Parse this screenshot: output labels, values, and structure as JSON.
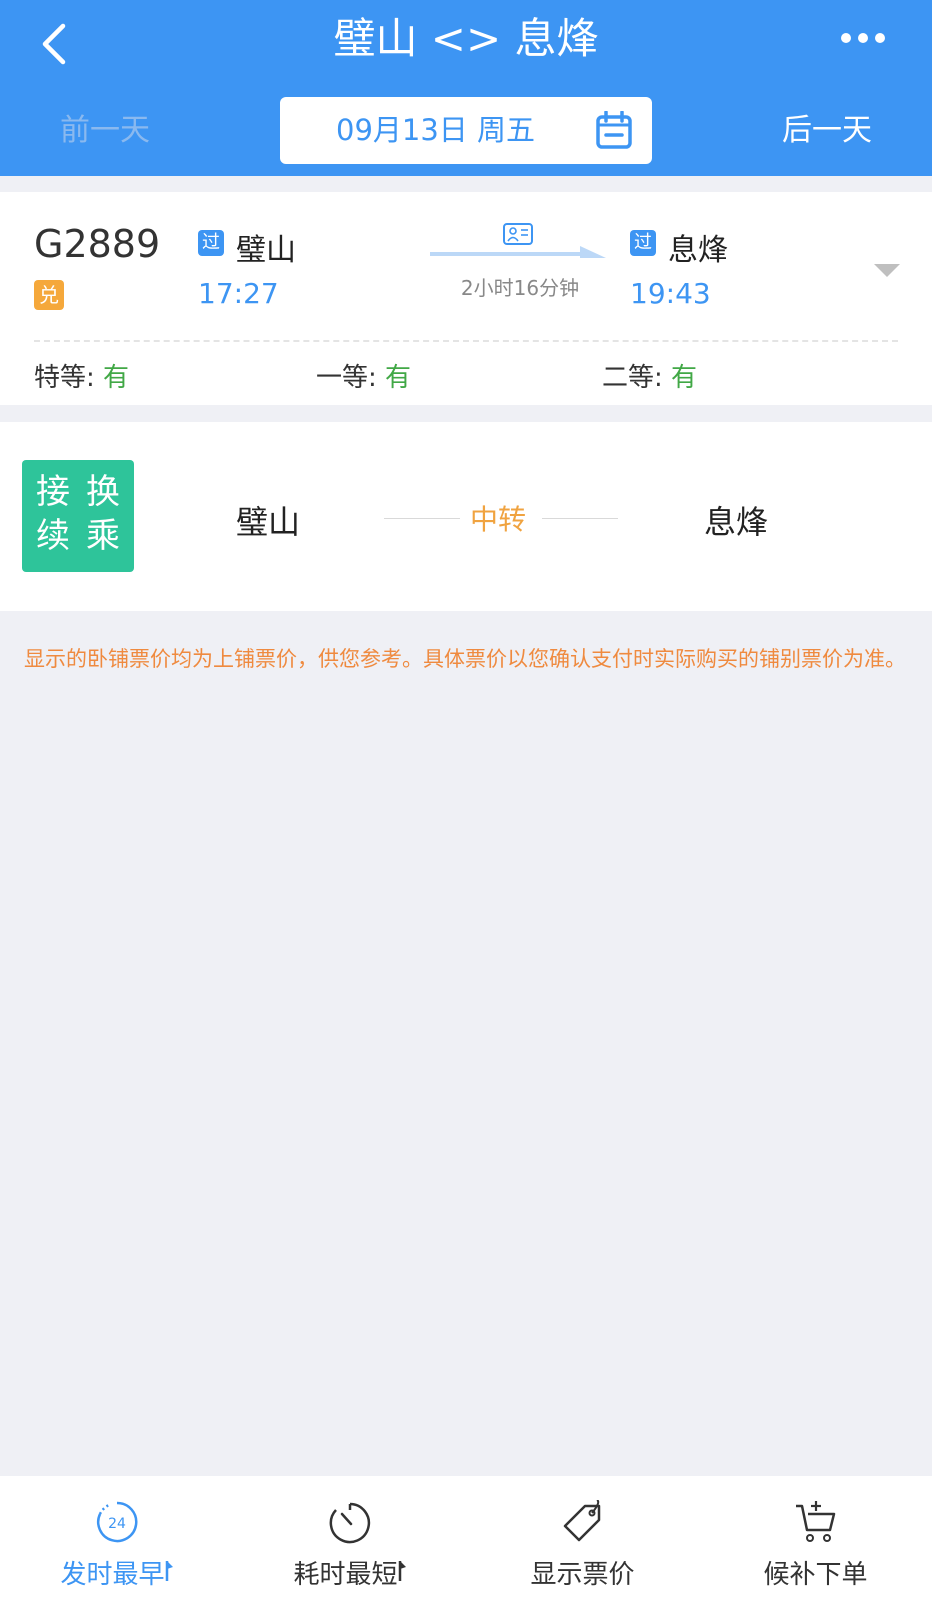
{
  "header": {
    "title": "璧山 <> 息烽",
    "prev_day": "前一天",
    "next_day": "后一天",
    "date": "09月13日 周五"
  },
  "train": {
    "number": "G2889",
    "badge": "兑",
    "from": {
      "tag": "过",
      "station": "璧山",
      "time": "17:27"
    },
    "to": {
      "tag": "过",
      "station": "息烽",
      "time": "19:43"
    },
    "duration": "2小时16分钟",
    "seats": [
      {
        "label": "特等:",
        "value": "有"
      },
      {
        "label": "一等:",
        "value": "有"
      },
      {
        "label": "二等:",
        "value": "有"
      }
    ]
  },
  "transfer": {
    "badge_chars": [
      "接",
      "换",
      "续",
      "乘"
    ],
    "from": "璧山",
    "middle": "中转",
    "to": "息烽"
  },
  "notice": "显示的卧铺票价均为上铺票价，供您参考。具体票价以您确认支付时实际购买的铺别票价为准。",
  "tabbar": {
    "items": [
      {
        "label": "发时最早",
        "icon": "clock-24-icon",
        "icon_text": "24",
        "active": true
      },
      {
        "label": "耗时最短",
        "icon": "stopwatch-icon",
        "active": false
      },
      {
        "label": "显示票价",
        "icon": "price-tag-icon",
        "active": false
      },
      {
        "label": "候补下单",
        "icon": "cart-add-icon",
        "active": false
      }
    ]
  },
  "colors": {
    "primary": "#3d95f3",
    "available": "#41a846",
    "accent": "#f0a340",
    "transfer_badge": "#2ec49a"
  }
}
